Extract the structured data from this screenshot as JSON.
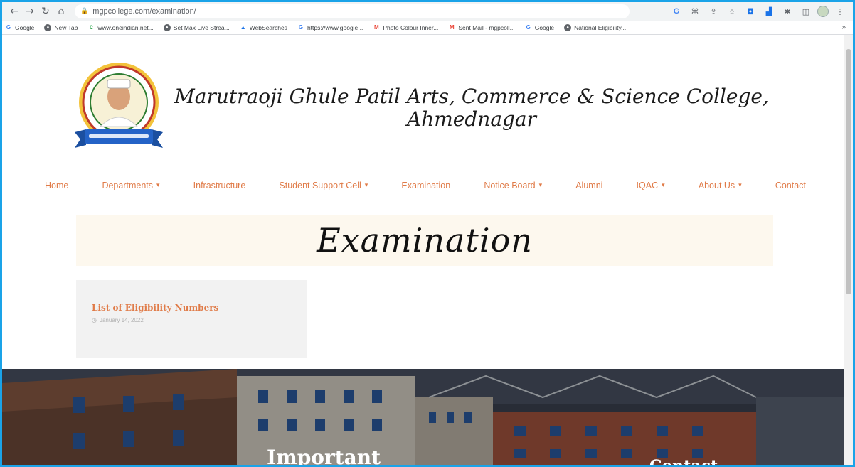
{
  "browser": {
    "url": "mgpcollege.com/examination/",
    "bookmarks": [
      {
        "icon": "google-g",
        "label": "Google"
      },
      {
        "icon": "globe",
        "label": "New Tab"
      },
      {
        "icon": "c-logo",
        "label": "www.oneindian.net..."
      },
      {
        "icon": "globe",
        "label": "Set Max Live Strea..."
      },
      {
        "icon": "photo",
        "label": "WebSearches"
      },
      {
        "icon": "google-g",
        "label": "https://www.google..."
      },
      {
        "icon": "gmail",
        "label": "Photo Colour Inner..."
      },
      {
        "icon": "gmail",
        "label": "Sent Mail - mgpcoll..."
      },
      {
        "icon": "google-g",
        "label": "Google"
      },
      {
        "icon": "globe",
        "label": "National Eligibility..."
      }
    ]
  },
  "site": {
    "title_line1": "Marutraoji Ghule Patil Arts, Commerce & Science College,",
    "title_line2": "Ahmednagar",
    "menu": [
      {
        "label": "Home",
        "dropdown": false
      },
      {
        "label": "Departments",
        "dropdown": true
      },
      {
        "label": "Infrastructure",
        "dropdown": false
      },
      {
        "label": "Student Support Cell",
        "dropdown": true
      },
      {
        "label": "Examination",
        "dropdown": false
      },
      {
        "label": "Notice Board",
        "dropdown": true
      },
      {
        "label": "Alumni",
        "dropdown": false
      },
      {
        "label": "IQAC",
        "dropdown": true
      },
      {
        "label": "About Us",
        "dropdown": true
      },
      {
        "label": "Contact",
        "dropdown": false
      }
    ],
    "page_title": "Examination",
    "post": {
      "title": "List of Eligibility Numbers",
      "date": "January 14, 2022"
    },
    "footer": {
      "heading_left": "Important",
      "heading_right": "Contact"
    }
  },
  "colors": {
    "accent": "#e07b48",
    "banner_bg": "#fdf8ee",
    "frame_border": "#1aa3e8"
  }
}
